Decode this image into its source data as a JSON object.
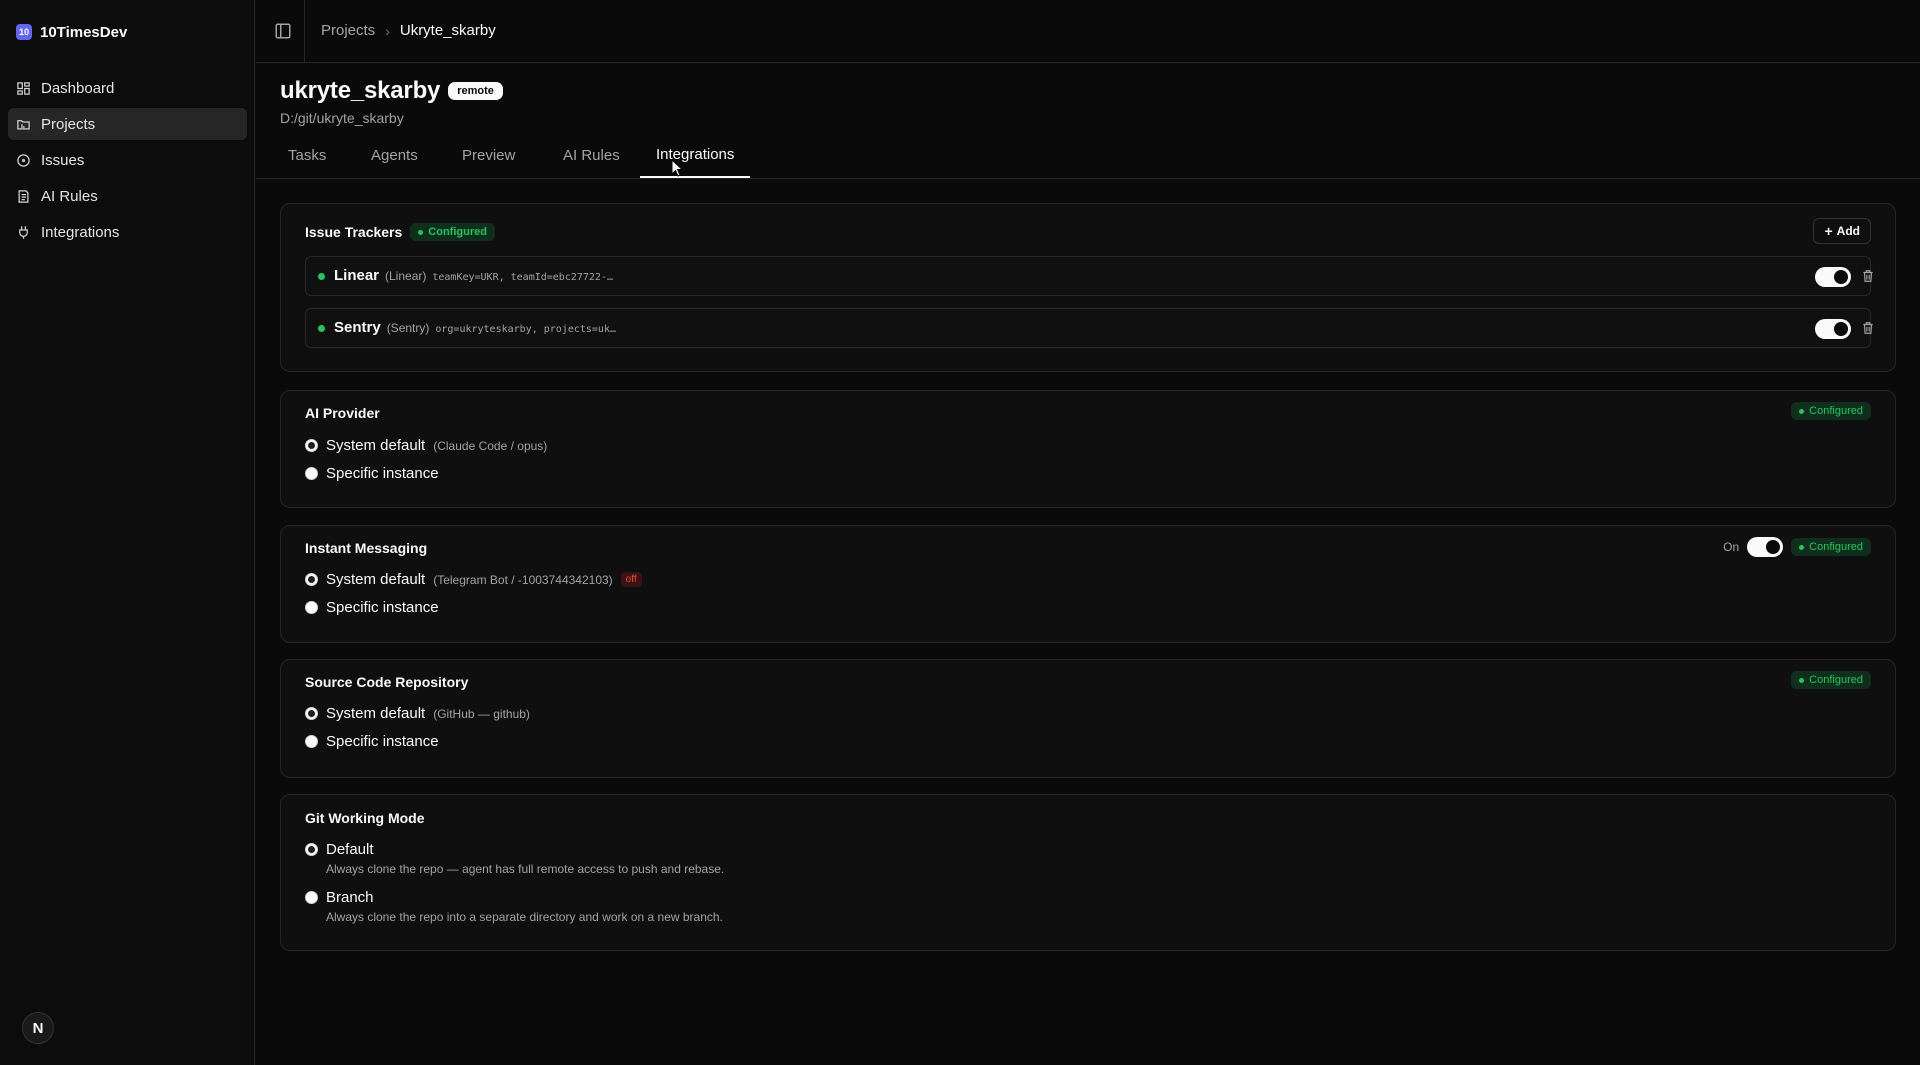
{
  "app": {
    "name": "10TimesDev",
    "logo_text": "10"
  },
  "sidebar": {
    "items": [
      {
        "label": "Dashboard",
        "icon": "dashboard-icon",
        "active": false
      },
      {
        "label": "Projects",
        "icon": "folder-icon",
        "active": true
      },
      {
        "label": "Issues",
        "icon": "circle-dot-icon",
        "active": false
      },
      {
        "label": "AI Rules",
        "icon": "rules-icon",
        "active": false
      },
      {
        "label": "Integrations",
        "icon": "plug-icon",
        "active": false
      }
    ],
    "avatar_letter": "N"
  },
  "breadcrumb": {
    "parent": "Projects",
    "separator": "›",
    "current": "Ukryte_skarby"
  },
  "project": {
    "title": "ukryte_skarby",
    "badge": "remote",
    "path": "D:/git/ukryte_skarby"
  },
  "tabs": [
    {
      "label": "Tasks",
      "active": false
    },
    {
      "label": "Agents",
      "active": false
    },
    {
      "label": "Preview",
      "active": false
    },
    {
      "label": "AI Rules",
      "active": false
    },
    {
      "label": "Integrations",
      "active": true
    }
  ],
  "issue_trackers": {
    "title": "Issue Trackers",
    "status": "Configured",
    "add_label": "Add",
    "items": [
      {
        "name": "Linear",
        "type": "(Linear)",
        "config": "teamKey=UKR, teamId=ebc27722-…",
        "enabled": true
      },
      {
        "name": "Sentry",
        "type": "(Sentry)",
        "config": "org=ukryteskarby, projects=uk…",
        "enabled": true
      }
    ]
  },
  "ai_provider": {
    "title": "AI Provider",
    "status": "Configured",
    "options": [
      {
        "label": "System default",
        "hint": "(Claude Code / opus)",
        "checked": true
      },
      {
        "label": "Specific instance",
        "hint": "",
        "checked": false
      }
    ]
  },
  "instant_messaging": {
    "title": "Instant Messaging",
    "toggle_label": "On",
    "enabled": true,
    "status": "Configured",
    "options": [
      {
        "label": "System default",
        "hint": "(Telegram Bot / -1003744342103)",
        "badge": "off",
        "checked": true
      },
      {
        "label": "Specific instance",
        "hint": "",
        "checked": false
      }
    ]
  },
  "source_code": {
    "title": "Source Code Repository",
    "status": "Configured",
    "options": [
      {
        "label": "System default",
        "hint": "(GitHub — github)",
        "checked": true
      },
      {
        "label": "Specific instance",
        "hint": "",
        "checked": false
      }
    ]
  },
  "git_mode": {
    "title": "Git Working Mode",
    "options": [
      {
        "label": "Default",
        "description": "Always clone the repo — agent has full remote access to push and rebase.",
        "checked": true
      },
      {
        "label": "Branch",
        "description": "Always clone the repo into a separate directory and work on a new branch.",
        "checked": false
      }
    ]
  },
  "colors": {
    "background": "#0a0a0a",
    "accent_green": "#22c55e",
    "danger": "#ef4444",
    "border": "#262626"
  }
}
